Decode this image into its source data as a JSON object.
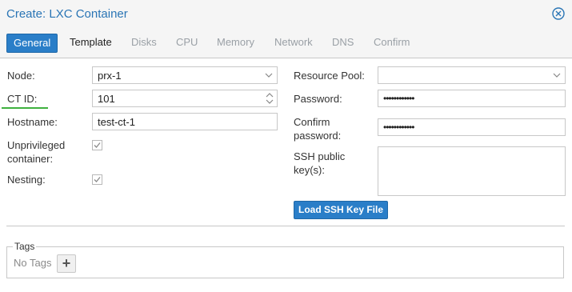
{
  "window": {
    "title": "Create: LXC Container"
  },
  "tabs": [
    {
      "label": "General"
    },
    {
      "label": "Template"
    },
    {
      "label": "Disks"
    },
    {
      "label": "CPU"
    },
    {
      "label": "Memory"
    },
    {
      "label": "Network"
    },
    {
      "label": "DNS"
    },
    {
      "label": "Confirm"
    }
  ],
  "left": {
    "node_label": "Node:",
    "node_value": "prx-1",
    "ctid_label": "CT ID:",
    "ctid_value": "101",
    "hostname_label": "Hostname:",
    "hostname_value": "test-ct-1",
    "unpriv_label_1": "Unprivileged",
    "unpriv_label_2": "container:",
    "nesting_label": "Nesting:"
  },
  "right": {
    "pool_label": "Resource Pool:",
    "pool_value": "",
    "password_label": "Password:",
    "password_value": "••••••••••••",
    "confirm_label_1": "Confirm",
    "confirm_label_2": "password:",
    "confirm_value": "••••••••••••",
    "ssh_label_1": "SSH public",
    "ssh_label_2": "key(s):",
    "ssh_value": "",
    "load_button": "Load SSH Key File"
  },
  "tags": {
    "legend": "Tags",
    "empty_text": "No Tags",
    "add_symbol": "+"
  },
  "colors": {
    "accent": "#2a7ec8",
    "title": "#2a75b5",
    "required_underline": "#3fb13f"
  }
}
